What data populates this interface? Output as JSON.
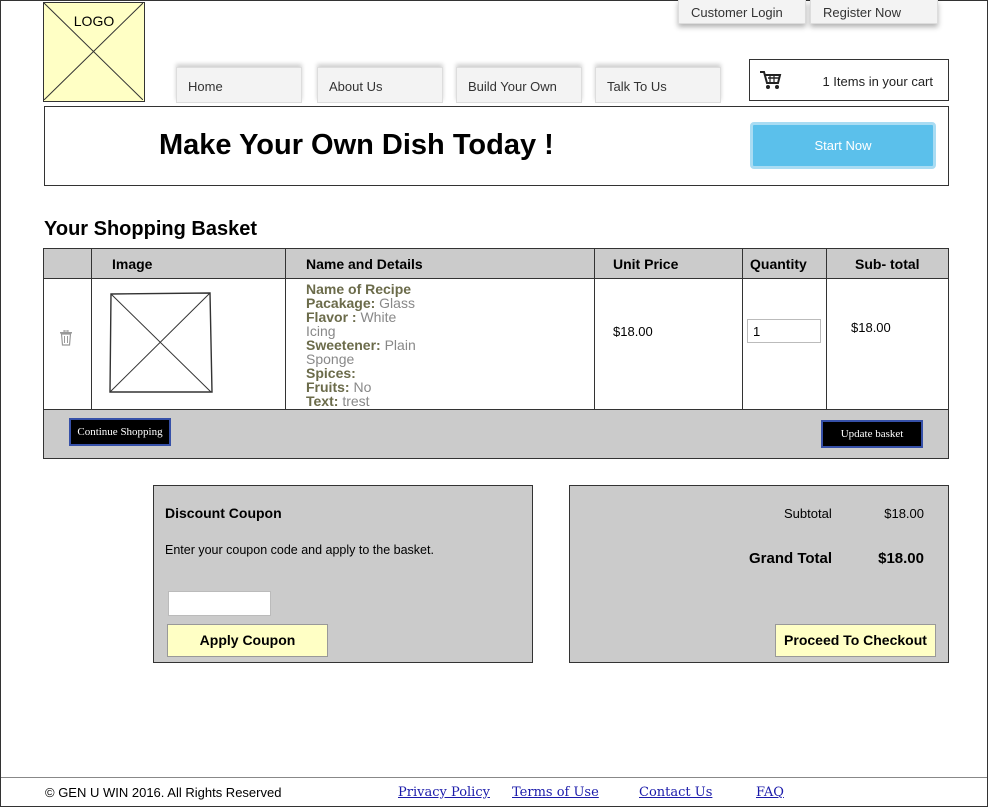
{
  "logo": {
    "label": "LOGO"
  },
  "top_links": {
    "login": "Customer Login",
    "register": "Register Now"
  },
  "nav": {
    "home": "Home",
    "about": "About Us",
    "build": "Build Your Own",
    "talk": "Talk To Us"
  },
  "cart": {
    "summary": "1 Items in your cart",
    "icon": "shopping-cart-icon"
  },
  "banner": {
    "title": "Make Your Own Dish Today !",
    "cta": "Start Now",
    "cta_color": "#5bc0eb"
  },
  "basket": {
    "title": "Your Shopping Basket",
    "columns": {
      "image": "Image",
      "details": "Name and Details",
      "unit_price": "Unit Price",
      "quantity": "Quantity",
      "subtotal": "Sub- total"
    },
    "item": {
      "name": "Name of Recipe",
      "package_label": "Pacakage:",
      "package": "Glass",
      "flavor_label": "Flavor :",
      "flavor_1": "White",
      "flavor_2": "Icing",
      "sweetener_label": "Sweetener:",
      "sweetener_1": "Plain",
      "sweetener_2": "Sponge",
      "spices_label": "Spices:",
      "spices": "",
      "fruits_label": "Fruits:",
      "fruits": "No",
      "text_label": "Text:",
      "text": "trest",
      "unit_price": "$18.00",
      "quantity": "1",
      "subtotal": "$18.00"
    },
    "continue_label": "Continue Shopping",
    "update_label": "Update basket"
  },
  "coupon": {
    "title": "Discount Coupon",
    "instructions": "Enter your coupon code and apply to the basket.",
    "code": "",
    "apply_label": "Apply Coupon"
  },
  "totals": {
    "subtotal_label": "Subtotal",
    "subtotal": "$18.00",
    "grand_label": "Grand Total",
    "grand": "$18.00",
    "checkout_label": "Proceed To Checkout"
  },
  "footer": {
    "copyright": "© GEN U WIN 2016. All Rights Reserved",
    "privacy": "Privacy Policy",
    "terms": "Terms of Use",
    "contact": "Contact Us",
    "faq": "FAQ"
  },
  "colors": {
    "panel": "#cbcbcb",
    "logo_bg": "#ffffc5",
    "button_dark": "#000000",
    "link": "#1a1aaa"
  }
}
